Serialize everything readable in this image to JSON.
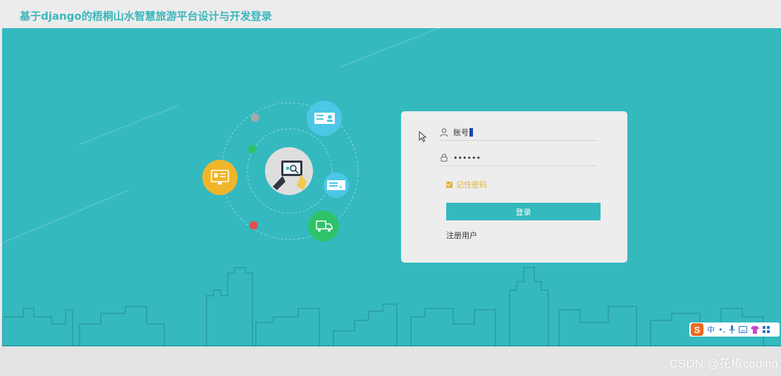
{
  "app": {
    "title": "基于django的梧桐山水智慧旅游平台设计与开发登录"
  },
  "login": {
    "account_value": "账号",
    "password_value": "••••••",
    "remember_label": "记住密码",
    "login_button": "登录",
    "register_link": "注册用户"
  },
  "ime": {
    "logo": "S",
    "mode": "中",
    "punct": "•,",
    "mic": "mic-icon",
    "keyboard": "keyboard-icon",
    "skin": "shirt-icon",
    "apps": "grid-icon"
  },
  "watermark": "CSDN @花椒coding",
  "colors": {
    "accent": "#34b9bf",
    "card": "#ededed",
    "remember": "#e0b43a"
  },
  "icons": [
    "user-icon",
    "lock-icon",
    "checkbox-icon",
    "mouse-pointer-icon",
    "monitor-icon",
    "id-card-icon",
    "payment-card-icon",
    "truck-icon",
    "tablet-search-icon"
  ]
}
